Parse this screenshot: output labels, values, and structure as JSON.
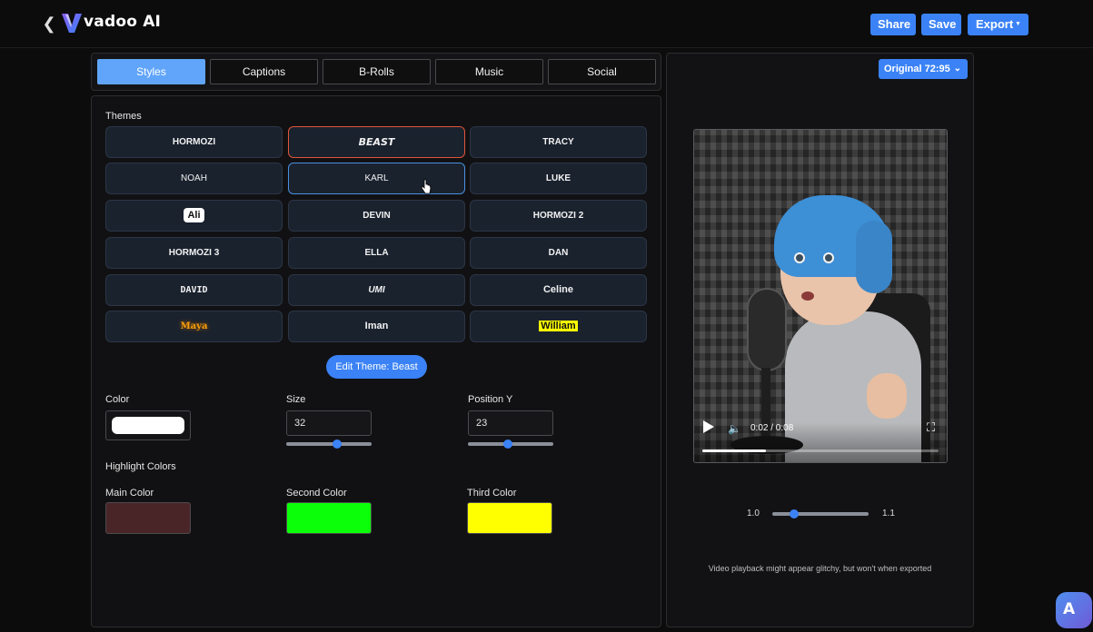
{
  "header": {
    "brand": "vadoo AI",
    "back_icon": "chevron-left-icon",
    "share_label": "Share",
    "save_label": "Save",
    "export_label": "Export",
    "accent": "#3b82f6"
  },
  "tabs": [
    {
      "label": "Styles",
      "active": true
    },
    {
      "label": "Captions",
      "active": false
    },
    {
      "label": "B-Rolls",
      "active": false
    },
    {
      "label": "Music",
      "active": false
    },
    {
      "label": "Social",
      "active": false
    }
  ],
  "themes": {
    "title": "Themes",
    "items": [
      {
        "label": "HORMOZI"
      },
      {
        "label": "BEAST",
        "state": "selected"
      },
      {
        "label": "TRACY"
      },
      {
        "label": "NOAH"
      },
      {
        "label": "KARL",
        "state": "hover"
      },
      {
        "label": "LUKE"
      },
      {
        "label": "Ali"
      },
      {
        "label": "DEVIN"
      },
      {
        "label": "HORMOZI 2"
      },
      {
        "label": "HORMOZI 3"
      },
      {
        "label": "ELLA"
      },
      {
        "label": "DAN"
      },
      {
        "label": "DAVID"
      },
      {
        "label": "UMI"
      },
      {
        "label": "Celine"
      },
      {
        "label": "Maya"
      },
      {
        "label": "Iman"
      },
      {
        "label": "William"
      }
    ],
    "edit_button": "Edit Theme: Beast"
  },
  "style": {
    "color_label": "Color",
    "color_value": "#ffffff",
    "size_label": "Size",
    "size_value": "32",
    "size_slider_fraction": 0.6,
    "position_label": "Position Y",
    "position_value": "23",
    "position_slider_fraction": 0.47
  },
  "highlight": {
    "title": "Highlight Colors",
    "main_label": "Main Color",
    "main_color": "#4a2528",
    "second_label": "Second Color",
    "second_color": "#0bff08",
    "third_label": "Third Color",
    "third_color": "#ffff00"
  },
  "preview": {
    "ratio_label": "Original 72:95",
    "time": "0:02 / 0:08",
    "progress_fraction": 0.27,
    "zoom_min": "1.0",
    "zoom_max": "1.1",
    "zoom_fraction": 0.23,
    "note": "Video playback might appear glitchy, but won't when exported"
  }
}
